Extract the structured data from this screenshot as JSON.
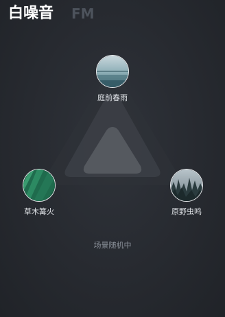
{
  "header": {
    "tabs": [
      {
        "label": "白噪音",
        "active": true
      },
      {
        "label": "FM",
        "active": false
      }
    ]
  },
  "scenes": {
    "top": {
      "label": "庭前春雨",
      "icon": "rain-lake-thumbnail"
    },
    "left": {
      "label": "草木篝火",
      "icon": "green-leaves-thumbnail"
    },
    "right": {
      "label": "原野虫鸣",
      "icon": "forest-trees-thumbnail"
    }
  },
  "status": {
    "text": "场景随机中"
  },
  "colors": {
    "background": "#2b2f36",
    "active_tab": "#ffffff",
    "inactive_tab": "#4d535c",
    "triangle_inner": "#55595f",
    "status_text": "#8a9099"
  }
}
